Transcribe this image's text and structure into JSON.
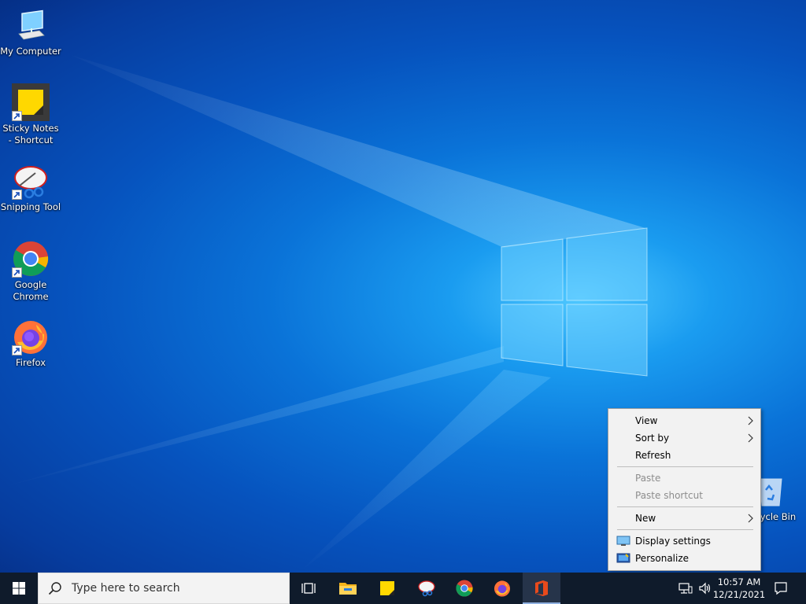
{
  "desktop": {
    "icons": [
      {
        "label": "My Computer",
        "icon": "computer-icon",
        "shortcut": false
      },
      {
        "label": "Sticky Notes - Shortcut",
        "icon": "sticky-notes-icon",
        "shortcut": true
      },
      {
        "label": "Snipping Tool",
        "icon": "snipping-tool-icon",
        "shortcut": true
      },
      {
        "label": "Google Chrome",
        "icon": "chrome-icon",
        "shortcut": true
      },
      {
        "label": "Firefox",
        "icon": "firefox-icon",
        "shortcut": true
      }
    ],
    "recycle_bin": {
      "label": "Recycle Bin",
      "icon": "recycle-bin-icon"
    }
  },
  "context_menu": {
    "view": "View",
    "sort_by": "Sort by",
    "refresh": "Refresh",
    "paste": "Paste",
    "paste_shortcut": "Paste shortcut",
    "new": "New",
    "display_settings": "Display settings",
    "personalize": "Personalize"
  },
  "taskbar": {
    "search_placeholder": "Type here to search",
    "pinned": [
      "task-view-icon",
      "file-explorer-icon",
      "sticky-notes-icon",
      "snipping-tool-icon",
      "chrome-icon",
      "firefox-icon",
      "office-icon"
    ],
    "active_app": "office-icon",
    "clock": {
      "time": "10:57 AM",
      "date": "12/21/2021"
    }
  },
  "colors": {
    "desktop_blue": "#0a73d8",
    "taskbar": "#0f1b2b",
    "menu_bg": "#f2f2f2",
    "disabled_text": "#8d8d8d"
  }
}
